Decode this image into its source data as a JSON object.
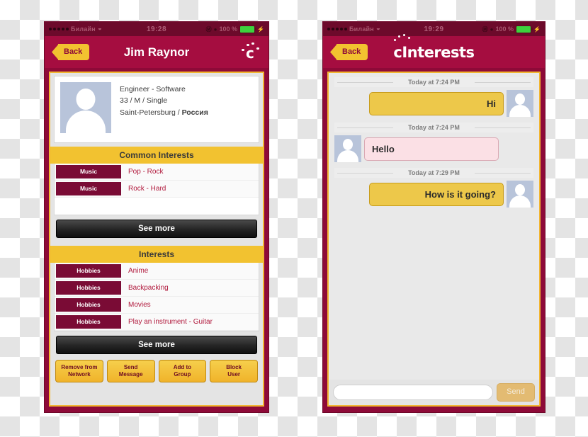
{
  "status_bar": {
    "signal_dots": 5,
    "carrier": "Билайн",
    "wifi_icon": "wifi-icon",
    "time_left": "19:28",
    "time_right": "19:29",
    "battery_percent": "100 %",
    "lock_icon": "rotation-lock-icon",
    "alarm_icon": "alarm-icon",
    "charging_icon": "charging-bolt-icon"
  },
  "left_phone": {
    "nav": {
      "back_label": "Back",
      "title": "Jim Raynor",
      "logo_icon": "cinterests-c-logo-icon"
    },
    "profile": {
      "avatar_icon": "avatar-placeholder-icon",
      "occupation": "Engineer - Software",
      "demographics": "33 / M / Single",
      "city": "Saint-Petersburg /",
      "country": "Россия"
    },
    "common_interests": {
      "header": "Common Interests",
      "rows": [
        {
          "tag": "Music",
          "value": "Pop - Rock"
        },
        {
          "tag": "Music",
          "value": "Rock - Hard"
        }
      ],
      "see_more_label": "See more"
    },
    "interests": {
      "header": "Interests",
      "rows": [
        {
          "tag": "Hobbies",
          "value": "Anime"
        },
        {
          "tag": "Hobbies",
          "value": "Backpacking"
        },
        {
          "tag": "Hobbies",
          "value": "Movies"
        },
        {
          "tag": "Hobbies",
          "value": "Play an instrument - Guitar"
        }
      ],
      "see_more_label": "See more"
    },
    "actions": [
      {
        "line1": "Remove from",
        "line2": "Network"
      },
      {
        "line1": "Send",
        "line2": "Message"
      },
      {
        "line1": "Add to",
        "line2": "Group"
      },
      {
        "line1": "Block",
        "line2": "User"
      }
    ]
  },
  "right_phone": {
    "nav": {
      "back_label": "Back",
      "wordmark": "cInterests",
      "logo_icon": "cinterests-wordmark-icon"
    },
    "messages": [
      {
        "separator": "Today at 7:24 PM",
        "text": "Hi",
        "direction": "out",
        "avatar_icon": "avatar-placeholder-icon"
      },
      {
        "separator": "Today at 7:24 PM",
        "text": "Hello",
        "direction": "in",
        "avatar_icon": "avatar-placeholder-icon"
      },
      {
        "separator": "Today at 7:29 PM",
        "text": "How is it going?",
        "direction": "out",
        "avatar_icon": "avatar-placeholder-icon"
      }
    ],
    "composer": {
      "input_value": "",
      "input_placeholder": "",
      "send_label": "Send"
    }
  },
  "colors": {
    "brand_maroon": "#a50d40",
    "frame_maroon": "#8e0a38",
    "status_maroon": "#6d0a2b",
    "accent_yellow": "#f2c230",
    "tag_maroon": "#7a0b35",
    "value_red": "#b11a3d",
    "bubble_out": "#edc84a",
    "bubble_in": "#fbe0e5",
    "avatar_blue": "#b8c4da"
  }
}
